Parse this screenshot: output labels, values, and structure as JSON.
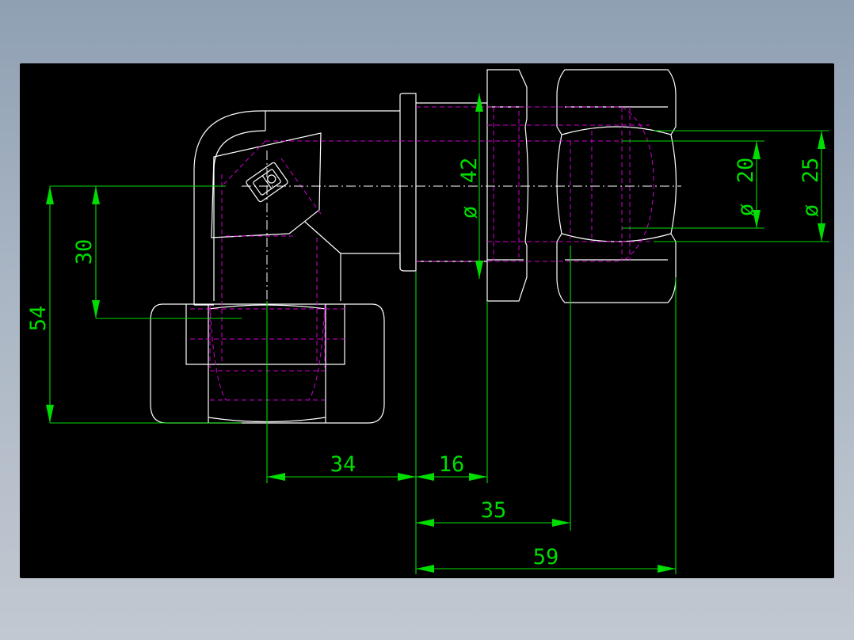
{
  "drawing": {
    "colors": {
      "background": "#000000",
      "outline": "#ffffff",
      "hidden_lines": "#d000d0",
      "dimensions": "#00dd00",
      "frame": "#8fa0b3"
    },
    "dimensions": {
      "h54": "54",
      "h30": "30",
      "d34": "34",
      "d16": "16",
      "d35": "35",
      "d59": "59",
      "dia42": "42",
      "dia20": "20",
      "dia25": "25",
      "dia_symbol": "ø"
    }
  }
}
